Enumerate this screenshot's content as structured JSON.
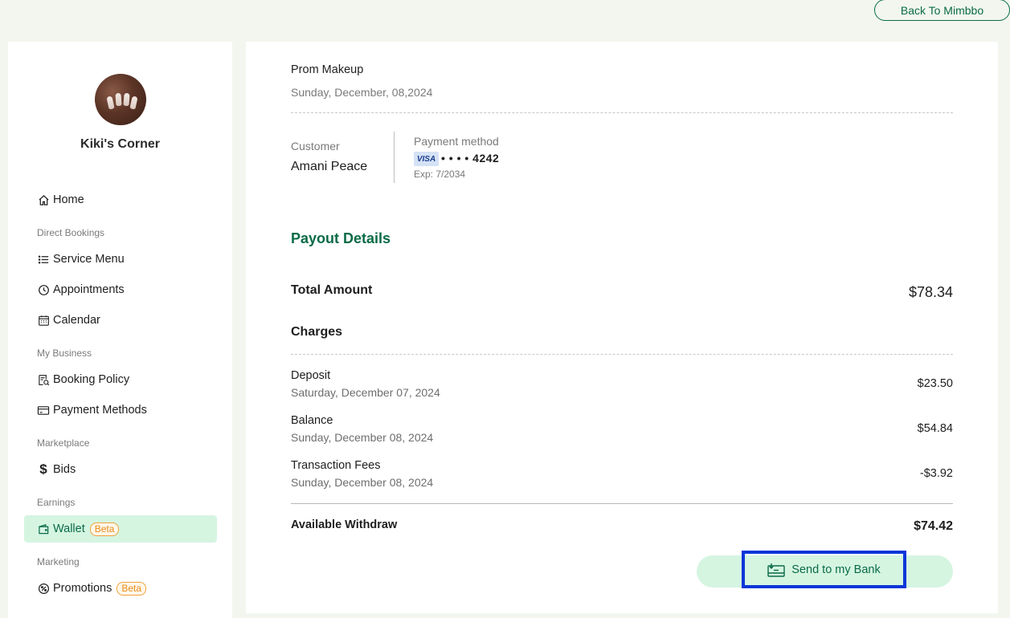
{
  "header": {
    "back_label": "Back To Mimbbo"
  },
  "sidebar": {
    "shop_name": "Kiki's Corner",
    "home": "Home",
    "sections": {
      "direct_bookings": "Direct Bookings",
      "my_business": "My Business",
      "marketplace": "Marketplace",
      "earnings": "Earnings",
      "marketing": "Marketing"
    },
    "items": {
      "service_menu": "Service Menu",
      "appointments": "Appointments",
      "calendar": "Calendar",
      "booking_policy": "Booking Policy",
      "payment_methods": "Payment Methods",
      "bids": "Bids",
      "wallet": "Wallet",
      "promotions": "Promotions"
    },
    "beta_badge": "Beta",
    "active_item": "wallet"
  },
  "booking": {
    "service": "Prom Makeup",
    "date": "Sunday, December, 08,2024",
    "customer_label": "Customer",
    "customer_name": "Amani Peace",
    "payment_method_label": "Payment method",
    "card_brand": "VISA",
    "card_number": "• • • • 4242",
    "card_expiry": "Exp: 7/2034"
  },
  "payout": {
    "title": "Payout Details",
    "total_label": "Total Amount",
    "total_value": "$78.34",
    "charges_label": "Charges",
    "charges": [
      {
        "name": "Deposit",
        "date": "Saturday, December 07, 2024",
        "amount": "$23.50"
      },
      {
        "name": "Balance",
        "date": "Sunday, December 08, 2024",
        "amount": "$54.84"
      },
      {
        "name": "Transaction Fees",
        "date": "Sunday, December 08, 2024",
        "amount": "-$3.92"
      }
    ],
    "available_label": "Available Withdraw",
    "available_value": "$74.42",
    "send_button": "Send to my Bank"
  },
  "colors": {
    "brand_green": "#0b6b47",
    "active_bg": "#d5f5e1",
    "badge_orange": "#e88d1b",
    "focus_outline": "#0a36d8"
  }
}
